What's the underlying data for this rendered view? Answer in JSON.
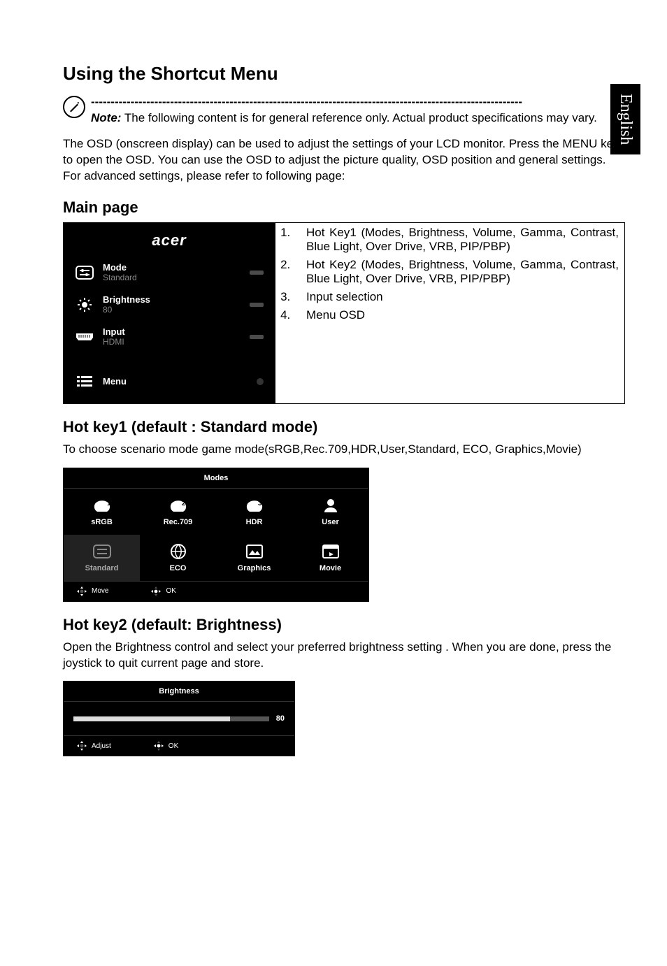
{
  "side_tab": "English",
  "title": "Using the Shortcut Menu",
  "note": {
    "dashes": "-------------------------------------------------------------------------------------------------------------",
    "label": "Note:",
    "text": " The following content is for general reference only. Actual product specifications may vary."
  },
  "intro": "The OSD (onscreen display) can be used to adjust the settings of your LCD monitor. Press the MENU key to open the OSD. You can use the OSD to adjust the picture quality, OSD position and general settings. For advanced settings, please refer to following page:",
  "main_page": {
    "heading": "Main page",
    "brand": "acer",
    "rows": [
      {
        "title": "Mode",
        "sub": "Standard",
        "icon": "mode-icon",
        "ind": "bar"
      },
      {
        "title": "Brightness",
        "sub": "80",
        "icon": "brightness-icon",
        "ind": "bar"
      },
      {
        "title": "Input",
        "sub": "HDMI",
        "icon": "input-icon",
        "ind": "bar"
      },
      {
        "title": "Menu",
        "sub": "",
        "icon": "menu-icon",
        "ind": "dot"
      }
    ],
    "list": [
      "Hot Key1 (Modes, Brightness, Volume, Gamma, Contrast, Blue Light, Over Drive, VRB, PIP/PBP)",
      "Hot Key2 (Modes, Brightness, Volume, Gamma, Contrast, Blue Light, Over Drive, VRB, PIP/PBP)",
      "Input selection",
      "Menu OSD"
    ]
  },
  "hotkey1": {
    "heading": "Hot key1 (default : Standard mode)",
    "desc": "To choose scenario mode game mode(sRGB,Rec.709,HDR,User,Standard, ECO, Graphics,Movie)",
    "panel_title": "Modes",
    "modes": [
      {
        "label": "sRGB",
        "icon": "game1-icon"
      },
      {
        "label": "Rec.709",
        "icon": "game2-icon"
      },
      {
        "label": "HDR",
        "icon": "game3-icon"
      },
      {
        "label": "User",
        "icon": "user-icon"
      },
      {
        "label": "Standard",
        "icon": "standard-icon",
        "selected": true
      },
      {
        "label": "ECO",
        "icon": "eco-icon"
      },
      {
        "label": "Graphics",
        "icon": "graphics-icon"
      },
      {
        "label": "Movie",
        "icon": "movie-icon"
      }
    ],
    "foot": {
      "move": "Move",
      "ok": "OK"
    }
  },
  "hotkey2": {
    "heading": "Hot key2 (default:  Brightness)",
    "desc": "Open the Brightness control and select your preferred brightness setting . When you are done, press the joystick to quit current page and store.",
    "panel_title": "Brightness",
    "value": "80",
    "fill_percent": 80,
    "foot": {
      "adjust": "Adjust",
      "ok": "OK"
    }
  }
}
